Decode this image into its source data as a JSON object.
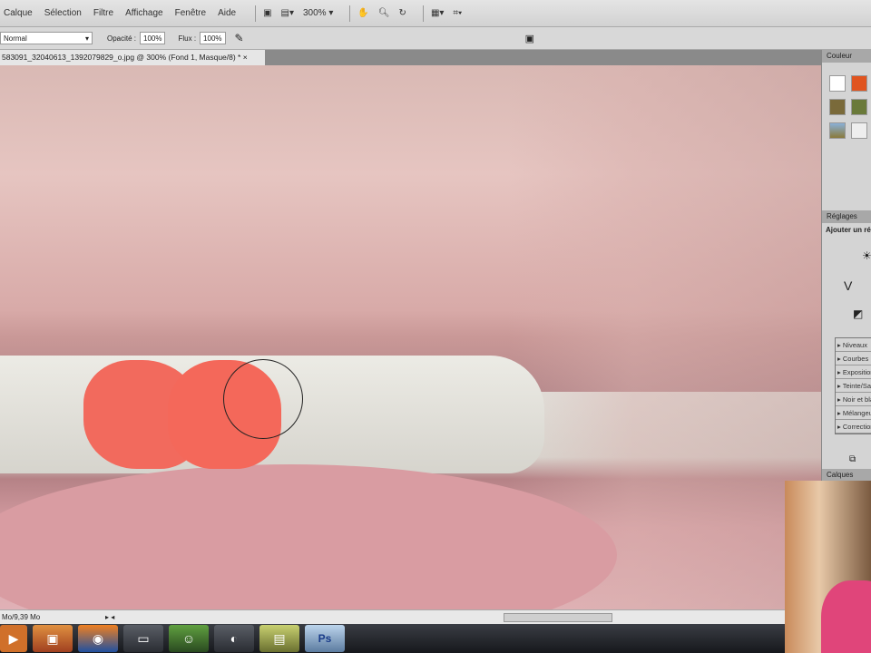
{
  "menu": [
    "Calque",
    "Sélection",
    "Filtre",
    "Affichage",
    "Fenêtre",
    "Aide"
  ],
  "toolbar": {
    "zoom": "300%"
  },
  "options": {
    "mode": "Normal",
    "opacity_label": "Opacité :",
    "opacity": "100%",
    "flow_label": "Flux :",
    "flow": "100%"
  },
  "document": {
    "tab_title": "583091_32040613_1392079829_o.jpg @ 300% (Fond 1, Masque/8) *",
    "close": "×"
  },
  "status": {
    "doc_size": "Mo/9,39 Mo"
  },
  "panel": {
    "color_tab": "Couleur",
    "adjust_tab": "Réglages",
    "adjust_heading": "Ajouter un réglage",
    "layers_tab": "Calques",
    "adjustments": [
      "Niveaux",
      "Courbes",
      "Exposition",
      "Teinte/Saturation",
      "Noir et blanc",
      "Mélangeur de couches",
      "Correction sélective"
    ]
  },
  "taskbar": [
    "media",
    "photos",
    "firefox",
    "explorer",
    "messenger",
    "app",
    "notes",
    "Ps"
  ]
}
